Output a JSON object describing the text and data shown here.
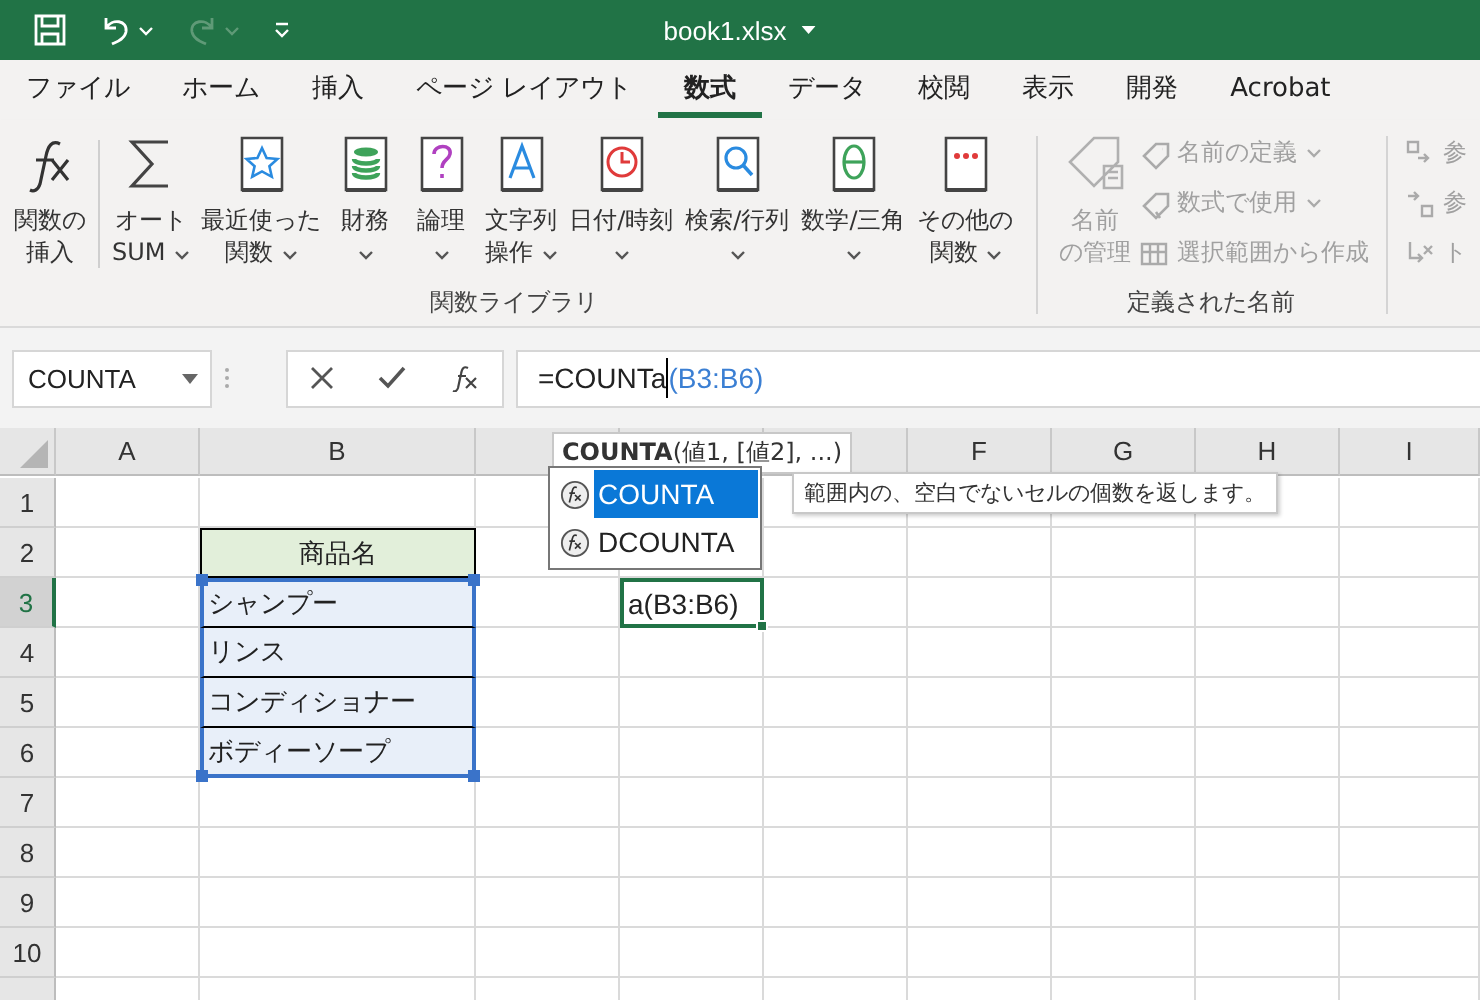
{
  "title_bar": {
    "title": "book1.xlsx",
    "redo_disabled": true
  },
  "tabs": [
    {
      "label": "ファイル",
      "selected": false
    },
    {
      "label": "ホーム",
      "selected": false
    },
    {
      "label": "挿入",
      "selected": false
    },
    {
      "label": "ページ レイアウト",
      "selected": false
    },
    {
      "label": "数式",
      "selected": true
    },
    {
      "label": "データ",
      "selected": false
    },
    {
      "label": "校閲",
      "selected": false
    },
    {
      "label": "表示",
      "selected": false
    },
    {
      "label": "開発",
      "selected": false
    },
    {
      "label": "Acrobat",
      "selected": false
    }
  ],
  "ribbon": {
    "function_library": {
      "label": "関数ライブラリ",
      "buttons": [
        {
          "kind": "fx",
          "lines": [
            "関数の",
            "挿入"
          ],
          "dropdown": false,
          "separator_after": true
        },
        {
          "kind": "sum",
          "lines": [
            "オート",
            "SUM"
          ],
          "dropdown": true,
          "separator_after": false
        },
        {
          "kind": "star",
          "lines": [
            "最近使った",
            "関数"
          ],
          "dropdown": true,
          "separator_after": false
        },
        {
          "kind": "finance",
          "lines": [
            "財務"
          ],
          "dropdown": true,
          "separator_after": false
        },
        {
          "kind": "logic",
          "lines": [
            "論理"
          ],
          "dropdown": true,
          "separator_after": false
        },
        {
          "kind": "text",
          "lines": [
            "文字列",
            "操作"
          ],
          "dropdown": true,
          "separator_after": false
        },
        {
          "kind": "clock",
          "lines": [
            "日付/時刻"
          ],
          "dropdown": true,
          "separator_after": false
        },
        {
          "kind": "search",
          "lines": [
            "検索/行列"
          ],
          "dropdown": true,
          "separator_after": false
        },
        {
          "kind": "theta",
          "lines": [
            "数学/三角"
          ],
          "dropdown": true,
          "separator_after": false
        },
        {
          "kind": "more",
          "lines": [
            "その他の",
            "関数"
          ],
          "dropdown": true,
          "separator_after": false
        }
      ]
    },
    "defined_names": {
      "label": "定義された名前",
      "large": {
        "lines": [
          "名前",
          "の管理"
        ],
        "disabled": true
      },
      "small": [
        {
          "kind": "tag",
          "label": "名前の定義",
          "dropdown": true,
          "disabled": true
        },
        {
          "kind": "formula-tag",
          "label": "数式で使用",
          "dropdown": true,
          "disabled": true
        },
        {
          "kind": "table",
          "label": "選択範囲から作成",
          "dropdown": false,
          "disabled": true
        }
      ]
    },
    "formula_auditing": {
      "small": [
        {
          "kind": "trace-in",
          "label": "参",
          "disabled": true
        },
        {
          "kind": "trace-out",
          "label": "参",
          "disabled": true
        },
        {
          "kind": "remove",
          "label": "ト",
          "disabled": true
        }
      ]
    }
  },
  "formula_bar": {
    "name_box": "COUNTA",
    "formula": {
      "text": "=COUNTa",
      "reference": "(B3:B6)"
    }
  },
  "sheet": {
    "columns": [
      {
        "label": "A"
      },
      {
        "label": "B"
      },
      {},
      {},
      {},
      {
        "label": "F"
      },
      {
        "label": "G"
      },
      {
        "label": "H"
      },
      {
        "label": "I"
      }
    ],
    "rows": [
      {
        "header": "1",
        "selected": false
      },
      {
        "header": "2",
        "selected": false,
        "cells": [
          {},
          {
            "text": "商品名",
            "kind": "header"
          }
        ]
      },
      {
        "header": "3",
        "selected": true,
        "cells": [
          {},
          {
            "text": "シャンプー",
            "kind": "range"
          },
          {},
          {
            "text": "a(B3:B6)",
            "kind": "active"
          }
        ]
      },
      {
        "header": "4",
        "selected": false,
        "cells": [
          {},
          {
            "text": "リンス",
            "kind": "range"
          }
        ]
      },
      {
        "header": "5",
        "selected": false,
        "cells": [
          {},
          {
            "text": "コンディショナー",
            "kind": "range"
          }
        ]
      },
      {
        "header": "6",
        "selected": false,
        "cells": [
          {},
          {
            "text": "ボディーソープ",
            "kind": "range"
          }
        ]
      },
      {
        "header": "7",
        "selected": false
      },
      {
        "header": "8",
        "selected": false
      },
      {
        "header": "9",
        "selected": false
      },
      {
        "header": "10",
        "selected": false
      }
    ]
  },
  "autocomplete": {
    "signature": "**COUNTA**(値1, [値2], ...)",
    "items": [
      {
        "label": "COUNTA",
        "selected": true
      },
      {
        "label": "DCOUNTA",
        "selected": false
      }
    ],
    "description": "範囲内の、空白でないセルの個数を返します。"
  }
}
